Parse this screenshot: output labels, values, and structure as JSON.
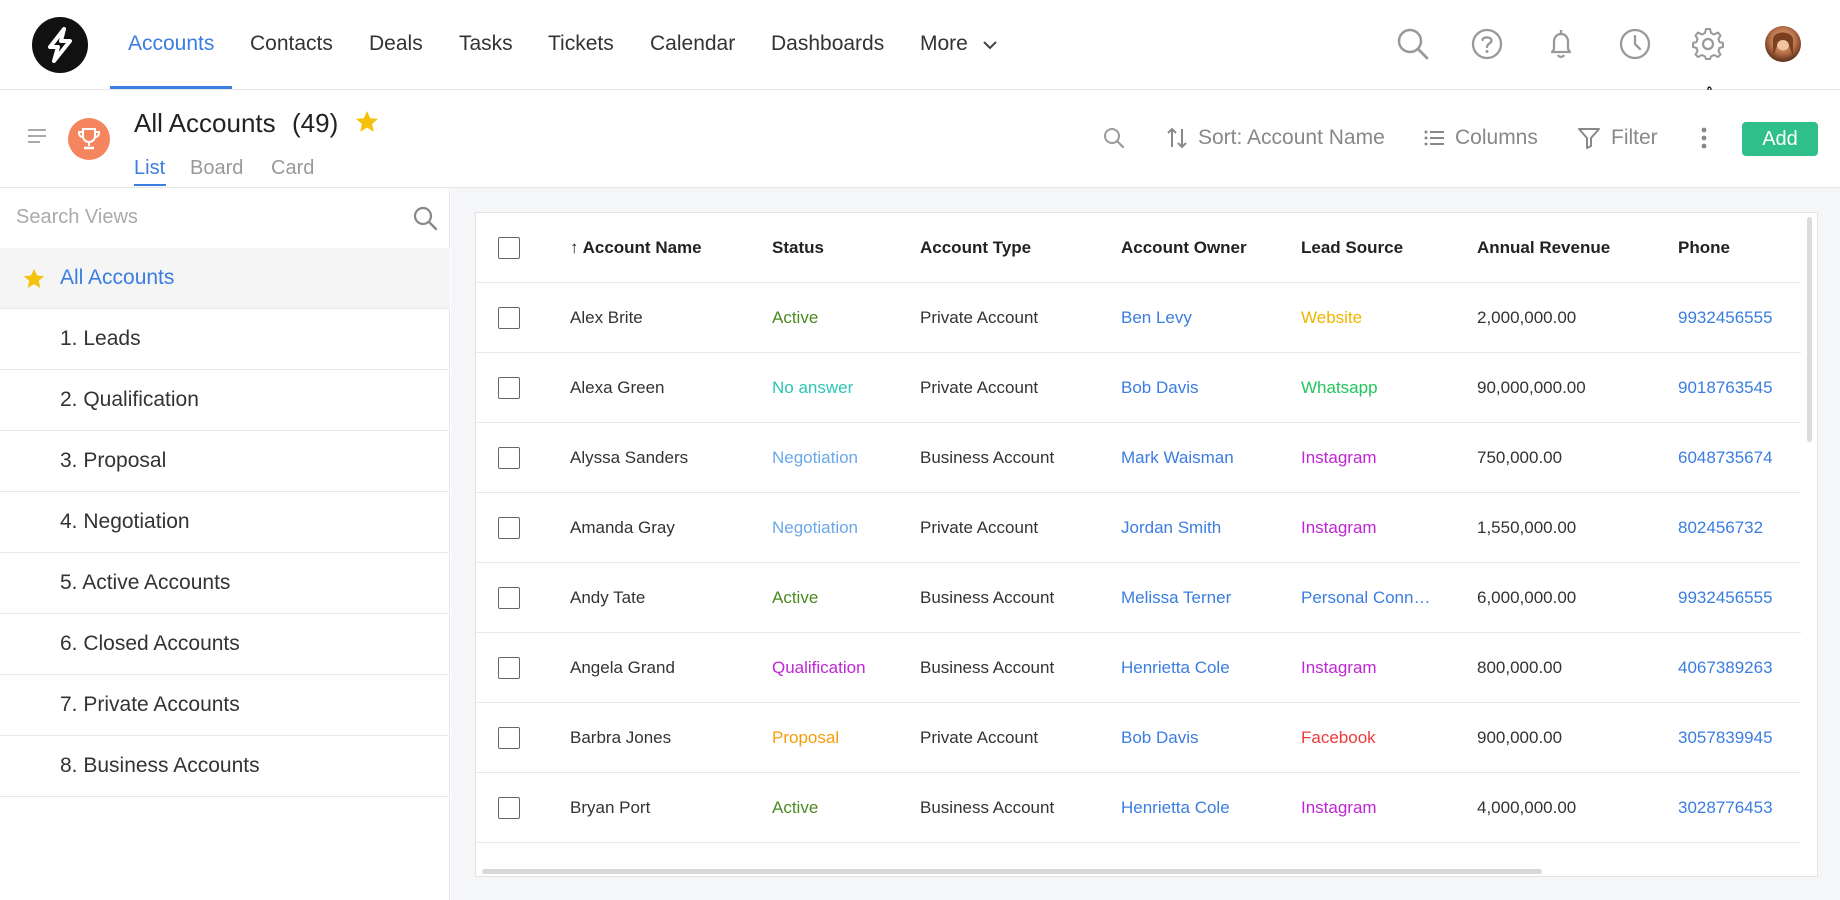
{
  "nav": {
    "items": [
      {
        "label": "Accounts",
        "active": true
      },
      {
        "label": "Contacts"
      },
      {
        "label": "Deals"
      },
      {
        "label": "Tasks"
      },
      {
        "label": "Tickets"
      },
      {
        "label": "Calendar"
      },
      {
        "label": "Dashboards"
      }
    ],
    "more_label": "More",
    "icons": [
      "search-icon",
      "help-icon",
      "bell-icon",
      "clock-icon",
      "gear-icon"
    ],
    "accent": "#3b7de0"
  },
  "header": {
    "title": "All Accounts",
    "count": "(49)",
    "tabs": [
      "List",
      "Board",
      "Card"
    ],
    "active_tab": "List",
    "sort_label": "Sort: Account Name",
    "columns_label": "Columns",
    "filter_label": "Filter",
    "add_label": "Add",
    "add_color": "#2fbf8a"
  },
  "sidebar": {
    "search_placeholder": "Search Views",
    "items": [
      {
        "label": "All Accounts",
        "active": true
      },
      {
        "label": "1. Leads"
      },
      {
        "label": "2. Qualification"
      },
      {
        "label": "3. Proposal"
      },
      {
        "label": "4. Negotiation"
      },
      {
        "label": "5. Active Accounts"
      },
      {
        "label": "6. Closed Accounts"
      },
      {
        "label": "7. Private Accounts"
      },
      {
        "label": "8. Business Accounts"
      }
    ]
  },
  "table": {
    "columns": [
      "Account Name",
      "Status",
      "Account Type",
      "Account Owner",
      "Lead Source",
      "Annual Revenue",
      "Phone"
    ],
    "sort_indicator": "↑",
    "rows": [
      {
        "name": "Alex Brite",
        "status": "Active",
        "type": "Private Account",
        "owner": "Ben Levy",
        "source": "Website",
        "revenue": "2,000,000.00",
        "phone": "9932456555"
      },
      {
        "name": "Alexa Green",
        "status": "No answer",
        "type": "Private Account",
        "owner": "Bob Davis",
        "source": "Whatsapp",
        "revenue": "90,000,000.00",
        "phone": "9018763545"
      },
      {
        "name": "Alyssa Sanders",
        "status": "Negotiation",
        "type": "Business Account",
        "owner": "Mark Waisman",
        "source": "Instagram",
        "revenue": "750,000.00",
        "phone": "6048735674"
      },
      {
        "name": "Amanda Gray",
        "status": "Negotiation",
        "type": "Private Account",
        "owner": "Jordan Smith",
        "source": "Instagram",
        "revenue": "1,550,000.00",
        "phone": "802456732"
      },
      {
        "name": "Andy Tate",
        "status": "Active",
        "type": "Business Account",
        "owner": "Melissa Terner",
        "source": "Personal Conn…",
        "revenue": "6,000,000.00",
        "phone": "9932456555"
      },
      {
        "name": "Angela Grand",
        "status": "Qualification",
        "type": "Business Account",
        "owner": "Henrietta Cole",
        "source": "Instagram",
        "revenue": "800,000.00",
        "phone": "4067389263"
      },
      {
        "name": "Barbra Jones",
        "status": "Proposal",
        "type": "Private Account",
        "owner": "Bob Davis",
        "source": "Facebook",
        "revenue": "900,000.00",
        "phone": "3057839945"
      },
      {
        "name": "Bryan Port",
        "status": "Active",
        "type": "Business Account",
        "owner": "Henrietta Cole",
        "source": "Instagram",
        "revenue": "4,000,000.00",
        "phone": "3028776453"
      }
    ],
    "status_colors": {
      "Active": "#4a8a1f",
      "No answer": "#2ec4b6",
      "Negotiation": "#6aa8e8",
      "Qualification": "#c026d3",
      "Proposal": "#f59e0b"
    },
    "source_colors": {
      "Website": "#f0b400",
      "Whatsapp": "#22c55e",
      "Instagram": "#c026d3",
      "Personal Conn…": "#3b7de0",
      "Facebook": "#ef3b3b"
    },
    "link_color": "#3b7de0"
  }
}
